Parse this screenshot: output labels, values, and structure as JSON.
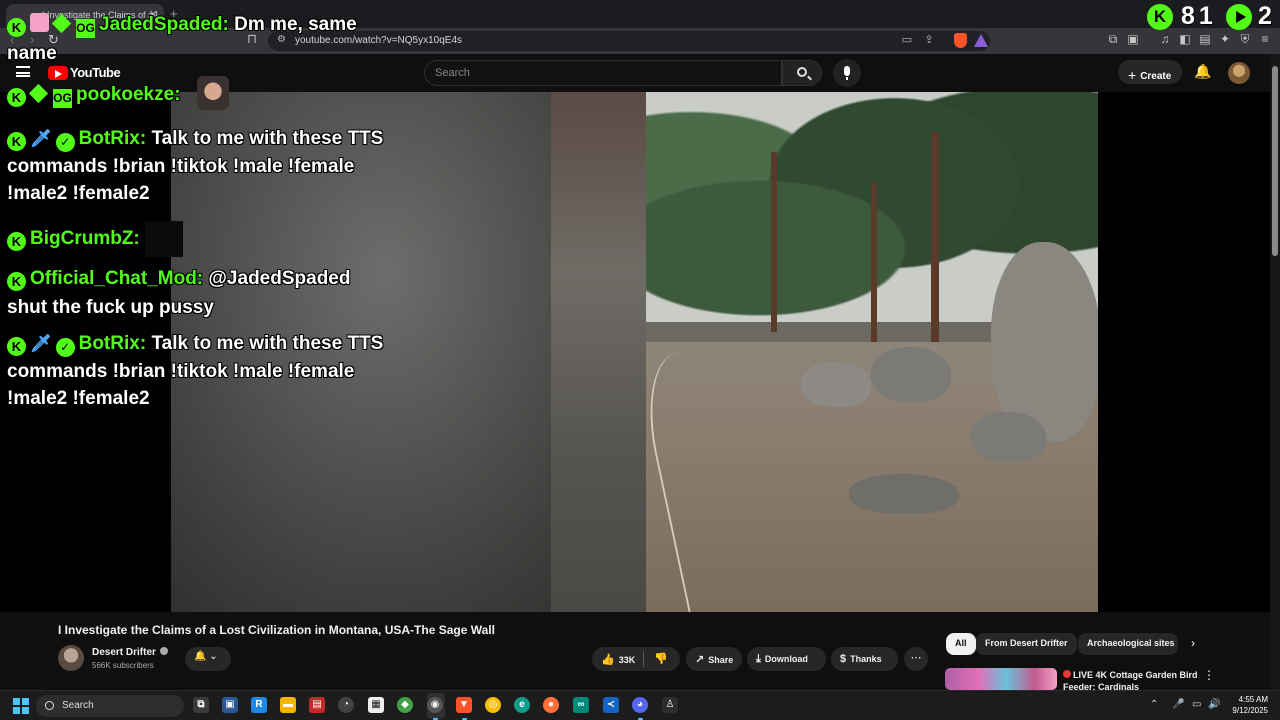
{
  "browser": {
    "tab_title": "I Investigate the Claims of a L",
    "url": "youtube.com/watch?v=NQ5yx10qE4s",
    "new_tab_symbol": "+"
  },
  "youtube": {
    "logo_text": "YouTube",
    "search_placeholder": "Search",
    "create_label": "Create"
  },
  "overlay": {
    "kick_stats": {
      "followers": "81",
      "viewers": "2"
    },
    "chat": [
      {
        "user": "JadedSpaded:",
        "text": "Dm me, same",
        "cont": "name"
      },
      {
        "user": "pookoekze:",
        "text": ""
      },
      {
        "user": "BotRix:",
        "text": "Talk to me with these TTS",
        "cont": "commands !brian !tiktok !male !female",
        "cont2": "!male2 !female2"
      },
      {
        "user": "BigCrumbZ:",
        "text": ""
      },
      {
        "user": "Official_Chat_Mod:",
        "text": "@JadedSpaded",
        "cont": "shut the fuck up pussy"
      },
      {
        "user": "BotRix:",
        "text": "Talk to me with these TTS",
        "cont": "commands !brian !tiktok !male !female",
        "cont2": "!male2 !female2"
      }
    ]
  },
  "video": {
    "title": "I Investigate the Claims of a Lost Civilization in Montana, USA-The Sage Wall",
    "channel": "Desert Drifter",
    "subscribers": "566K subscribers",
    "likes": "33K",
    "share_label": "Share",
    "download_label": "Download",
    "thanks_label": "Thanks"
  },
  "sidebar": {
    "chips": [
      "All",
      "From Desert Drifter",
      "Archaeological sites"
    ],
    "rec_title": "LIVE 4K Cottage Garden Bird Feeder: Cardinals"
  },
  "taskbar": {
    "search_label": "Search",
    "time": "4:55 AM",
    "date": "9/12/2025"
  },
  "colors": {
    "kick_green": "#53fc18",
    "youtube_red": "#ff0000"
  }
}
